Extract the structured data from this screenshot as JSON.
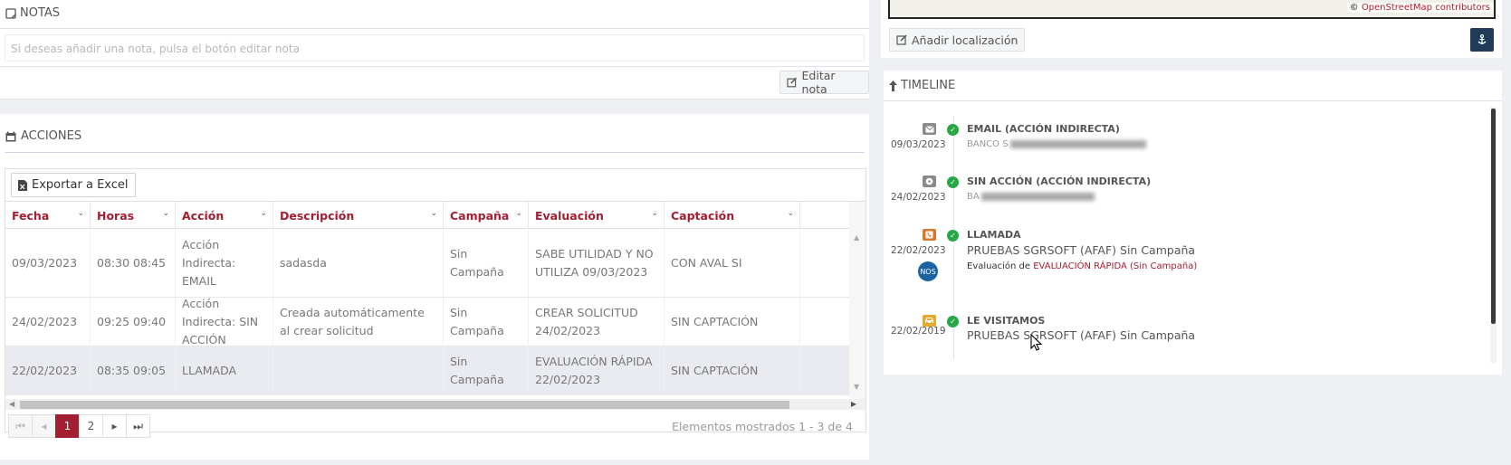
{
  "notas": {
    "title": "NOTAS",
    "placeholder": "Si deseas añadir una nota, pulsa el botón editar nota",
    "edit_label": "Editar nota"
  },
  "acciones": {
    "title": "ACCIONES",
    "export_label": "Exportar a Excel",
    "columns": [
      "Fecha",
      "Horas",
      "Acción",
      "Descripción",
      "Campaña",
      "Evaluación",
      "Captación"
    ],
    "rows": [
      {
        "fecha": "09/03/2023",
        "horas": "08:30 08:45",
        "accion": "Acción Indirecta: EMAIL",
        "descripcion": "sadasda",
        "campana": "Sin Campaña",
        "evaluacion": "SABE UTILIDAD Y NO UTILIZA 09/03/2023",
        "captacion": "CON AVAL SI"
      },
      {
        "fecha": "24/02/2023",
        "horas": "09:25 09:40",
        "accion": "Acción Indirecta: SIN ACCIÓN",
        "descripcion": "Creada automáticamente al crear solicitud",
        "campana": "Sin Campaña",
        "evaluacion": "CREAR SOLICITUD 24/02/2023",
        "captacion": "SIN CAPTACIÓN"
      },
      {
        "fecha": "22/02/2023",
        "horas": "08:35 09:05",
        "accion": "LLAMADA",
        "descripcion": "",
        "campana": "Sin Campaña",
        "evaluacion": "EVALUACIÓN RÁPIDA 22/02/2023",
        "captacion": "SIN CAPTACIÓN"
      }
    ],
    "pager": {
      "pages": [
        "1",
        "2"
      ],
      "current": "1",
      "info": "Elementos mostrados 1 - 3 de 4"
    }
  },
  "map": {
    "attribution_prefix": "©",
    "attribution_link": "OpenStreetMap contributors",
    "add_location_label": "Añadir localización"
  },
  "timeline": {
    "title": "TIMELINE",
    "items": [
      {
        "title": "EMAIL (ACCIÓN INDIRECTA)",
        "date": "09/03/2023",
        "subtitle": "BANCO S",
        "icon": "envelope-icon",
        "color": "#8a8a8a"
      },
      {
        "title": "SIN ACCIÓN (ACCIÓN INDIRECTA)",
        "date": "24/02/2023",
        "subtitle": "BA",
        "icon": "disc-icon",
        "color": "#8a8a8a"
      },
      {
        "title": "LLAMADA",
        "date": "22/02/2023",
        "subtitle": "PRUEBAS SGRSOFT (AFAF) Sin Campaña",
        "eval_prefix": "Evaluación de",
        "eval_value": "EVALUACIÓN RÁPIDA (Sin Campaña)",
        "badge": "NOS",
        "icon": "phone-icon",
        "color": "#d9782d"
      },
      {
        "title": "LE VISITAMOS",
        "date": "22/02/2019",
        "subtitle": "PRUEBAS SGRSOFT (AFAF) Sin Campaña",
        "icon": "car-icon",
        "color": "#e8a82a"
      }
    ]
  },
  "colors": {
    "accent": "#a31e30",
    "dark_button": "#1f3b58",
    "check": "#27a845"
  }
}
